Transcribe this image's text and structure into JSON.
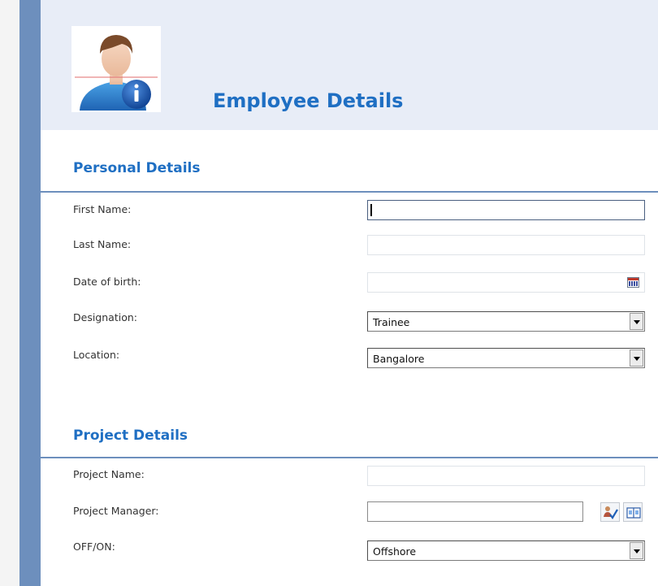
{
  "header": {
    "title": "Employee Details"
  },
  "sections": {
    "personal": {
      "title": "Personal Details",
      "fields": {
        "first_name": {
          "label": "First Name:",
          "value": ""
        },
        "last_name": {
          "label": "Last Name:",
          "value": ""
        },
        "dob": {
          "label": "Date of birth:",
          "value": ""
        },
        "designation": {
          "label": "Designation:",
          "value": "Trainee"
        },
        "location": {
          "label": "Location:",
          "value": "Bangalore"
        }
      }
    },
    "project": {
      "title": "Project Details",
      "fields": {
        "project_name": {
          "label": "Project Name:",
          "value": ""
        },
        "project_manager": {
          "label": "Project Manager:",
          "value": ""
        },
        "off_on": {
          "label": "OFF/ON:",
          "value": "Offshore"
        }
      }
    }
  },
  "icons": {
    "avatar": "employee-info-icon",
    "calendar": "calendar-icon",
    "check_names": "check-names-icon",
    "browse": "address-book-icon"
  },
  "colors": {
    "accent": "#1f6fc3",
    "sidebar": "#6d8fbd",
    "header_bg": "#e8edf7"
  }
}
